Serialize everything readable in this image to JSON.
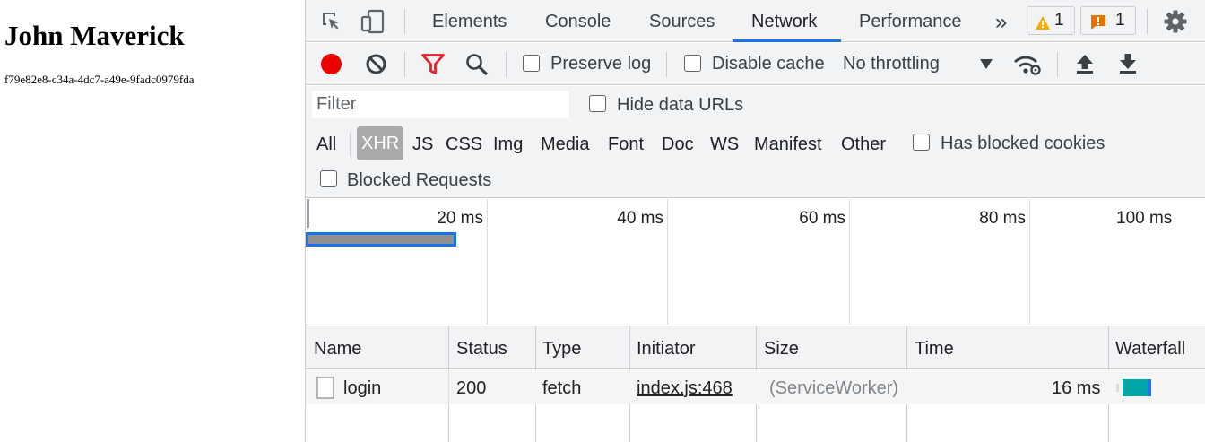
{
  "page": {
    "heading": "John Maverick",
    "id": "f79e82e8-c34a-4dc7-a49e-9fadc0979fda"
  },
  "devtools": {
    "tabs": [
      "Elements",
      "Console",
      "Sources",
      "Network",
      "Performance"
    ],
    "more_tabs": "»",
    "active_tab": "Network",
    "warnings_count": "1",
    "issues_count": "1",
    "accent": "#1a73e8",
    "toolbar": {
      "preserve_log": "Preserve log",
      "disable_cache": "Disable cache",
      "throttling": "No throttling",
      "record_color": "#ee0000",
      "filter_icon_color": "#e8212a"
    },
    "filter": {
      "placeholder": "Filter",
      "hide_data_urls": "Hide data URLs",
      "types": [
        "All",
        "XHR",
        "JS",
        "CSS",
        "Img",
        "Media",
        "Font",
        "Doc",
        "WS",
        "Manifest",
        "Other"
      ],
      "active_type": "XHR",
      "has_blocked_cookies": "Has blocked cookies",
      "blocked_requests": "Blocked Requests"
    },
    "overview": {
      "ticks": [
        "20 ms",
        "40 ms",
        "60 ms",
        "80 ms",
        "100 ms"
      ]
    },
    "table": {
      "columns": [
        "Name",
        "Status",
        "Type",
        "Initiator",
        "Size",
        "Time",
        "Waterfall"
      ],
      "rows": [
        {
          "name": "login",
          "status": "200",
          "type": "fetch",
          "initiator": "index.js:468",
          "size": "(ServiceWorker)",
          "time": "16 ms"
        }
      ]
    }
  }
}
